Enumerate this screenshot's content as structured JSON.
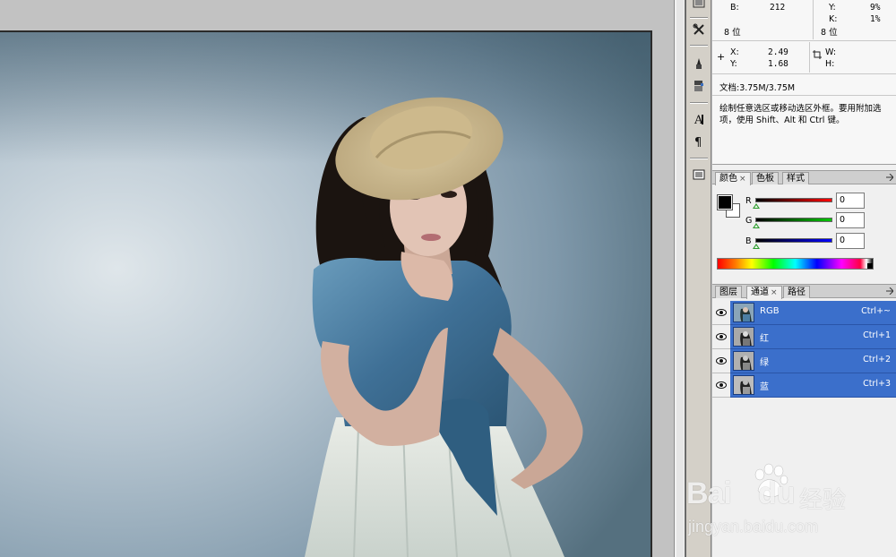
{
  "info_panel": {
    "b_label": "B:",
    "b_value": "212",
    "y_label": "Y:",
    "y_value": "9%",
    "k_label": "K:",
    "k_value": "1%",
    "bit_depth_left": "8 位",
    "bit_depth_right": "8 位",
    "x_label": "X:",
    "x_value": "2.49",
    "y_coord_label": "Y:",
    "y_coord_value": "1.68",
    "w_label": "W:",
    "h_label": "H:",
    "doc_size": "文档:3.75M/3.75M",
    "hint_line1": "绘制任意选区或移动选区外框。要用附加选",
    "hint_line2": "项，使用 Shift、Alt 和 Ctrl 键。"
  },
  "color_panel": {
    "tabs": [
      {
        "label": "颜色",
        "close": "×"
      },
      {
        "label": "色板"
      },
      {
        "label": "样式"
      }
    ],
    "sliders": [
      {
        "label": "R",
        "value": "0",
        "color": "#ff0000"
      },
      {
        "label": "G",
        "value": "0",
        "color": "#00c800"
      },
      {
        "label": "B",
        "value": "0",
        "color": "#0000ff"
      }
    ],
    "foreground": "#000000",
    "background": "#ffffff"
  },
  "channels_panel": {
    "tabs": [
      {
        "label": "图层"
      },
      {
        "label": "通道",
        "close": "×"
      },
      {
        "label": "路径"
      }
    ],
    "channels": [
      {
        "name": "RGB",
        "shortcut": "Ctrl+~"
      },
      {
        "name": "红",
        "shortcut": "Ctrl+1"
      },
      {
        "name": "绿",
        "shortcut": "Ctrl+2"
      },
      {
        "name": "蓝",
        "shortcut": "Ctrl+3"
      }
    ],
    "selection_color": "#3b6fcb"
  },
  "tools": [
    {
      "icon": "navigator-icon"
    },
    {
      "icon": "tools-icon"
    },
    {
      "icon": "brush-icon"
    },
    {
      "icon": "clone-source-icon"
    },
    {
      "icon": "character-icon"
    },
    {
      "icon": "paragraph-icon"
    },
    {
      "icon": "layer-comps-icon"
    }
  ],
  "watermark": {
    "brand": "Bai",
    "brand2": "du",
    "cn": "经验",
    "url": "jingyan.baidu.com"
  }
}
